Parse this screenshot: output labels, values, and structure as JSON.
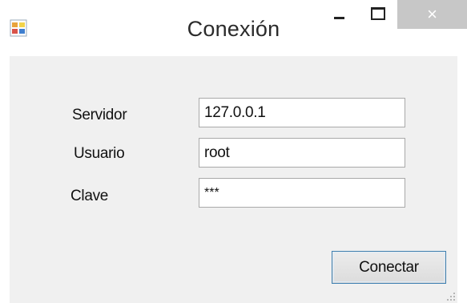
{
  "window": {
    "title": "Conexión",
    "close_glyph": "×",
    "icons": {
      "app": "app-window-icon",
      "minimize": "minimize-icon",
      "maximize": "maximize-icon",
      "close": "close-icon",
      "grip": "resize-grip-icon"
    },
    "colors": {
      "title_text": "#2b2b2b",
      "close_bg": "#c7c7c7",
      "client_bg": "#f0f0f0",
      "button_border": "#3c7fb1"
    }
  },
  "form": {
    "server_label": "Servidor",
    "server_value": "127.0.0.1",
    "user_label": "Usuario",
    "user_value": "root",
    "password_label": "Clave",
    "password_value": "***",
    "connect_label": "Conectar"
  }
}
